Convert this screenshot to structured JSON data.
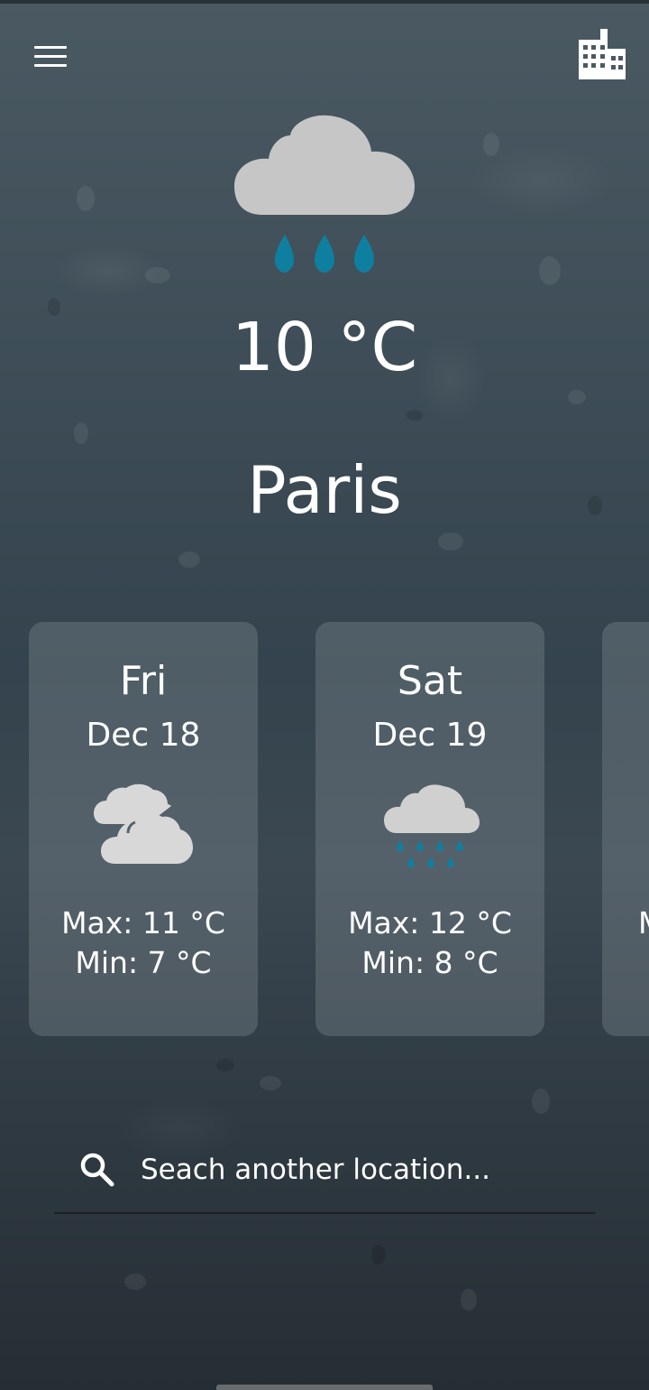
{
  "current": {
    "icon": "rain-cloud-icon",
    "temperature": "10 °C",
    "city": "Paris"
  },
  "header": {
    "menu_icon": "hamburger-menu-icon",
    "city_icon": "city-buildings-icon"
  },
  "forecast": [
    {
      "day": "Fri",
      "date": "Dec 18",
      "icon": "cloudy-icon",
      "max": "Max: 11 °C",
      "min": "Min: 7 °C"
    },
    {
      "day": "Sat",
      "date": "Dec 19",
      "icon": "heavy-rain-icon",
      "max": "Max: 12 °C",
      "min": "Min: 8 °C"
    },
    {
      "day": "",
      "date": "",
      "icon": "",
      "max": "M",
      "min": ""
    }
  ],
  "search": {
    "placeholder": "Seach another location...",
    "icon": "search-icon"
  },
  "colors": {
    "rain_drop": "#0f7fa0",
    "cloud": "#c6c6c6"
  }
}
